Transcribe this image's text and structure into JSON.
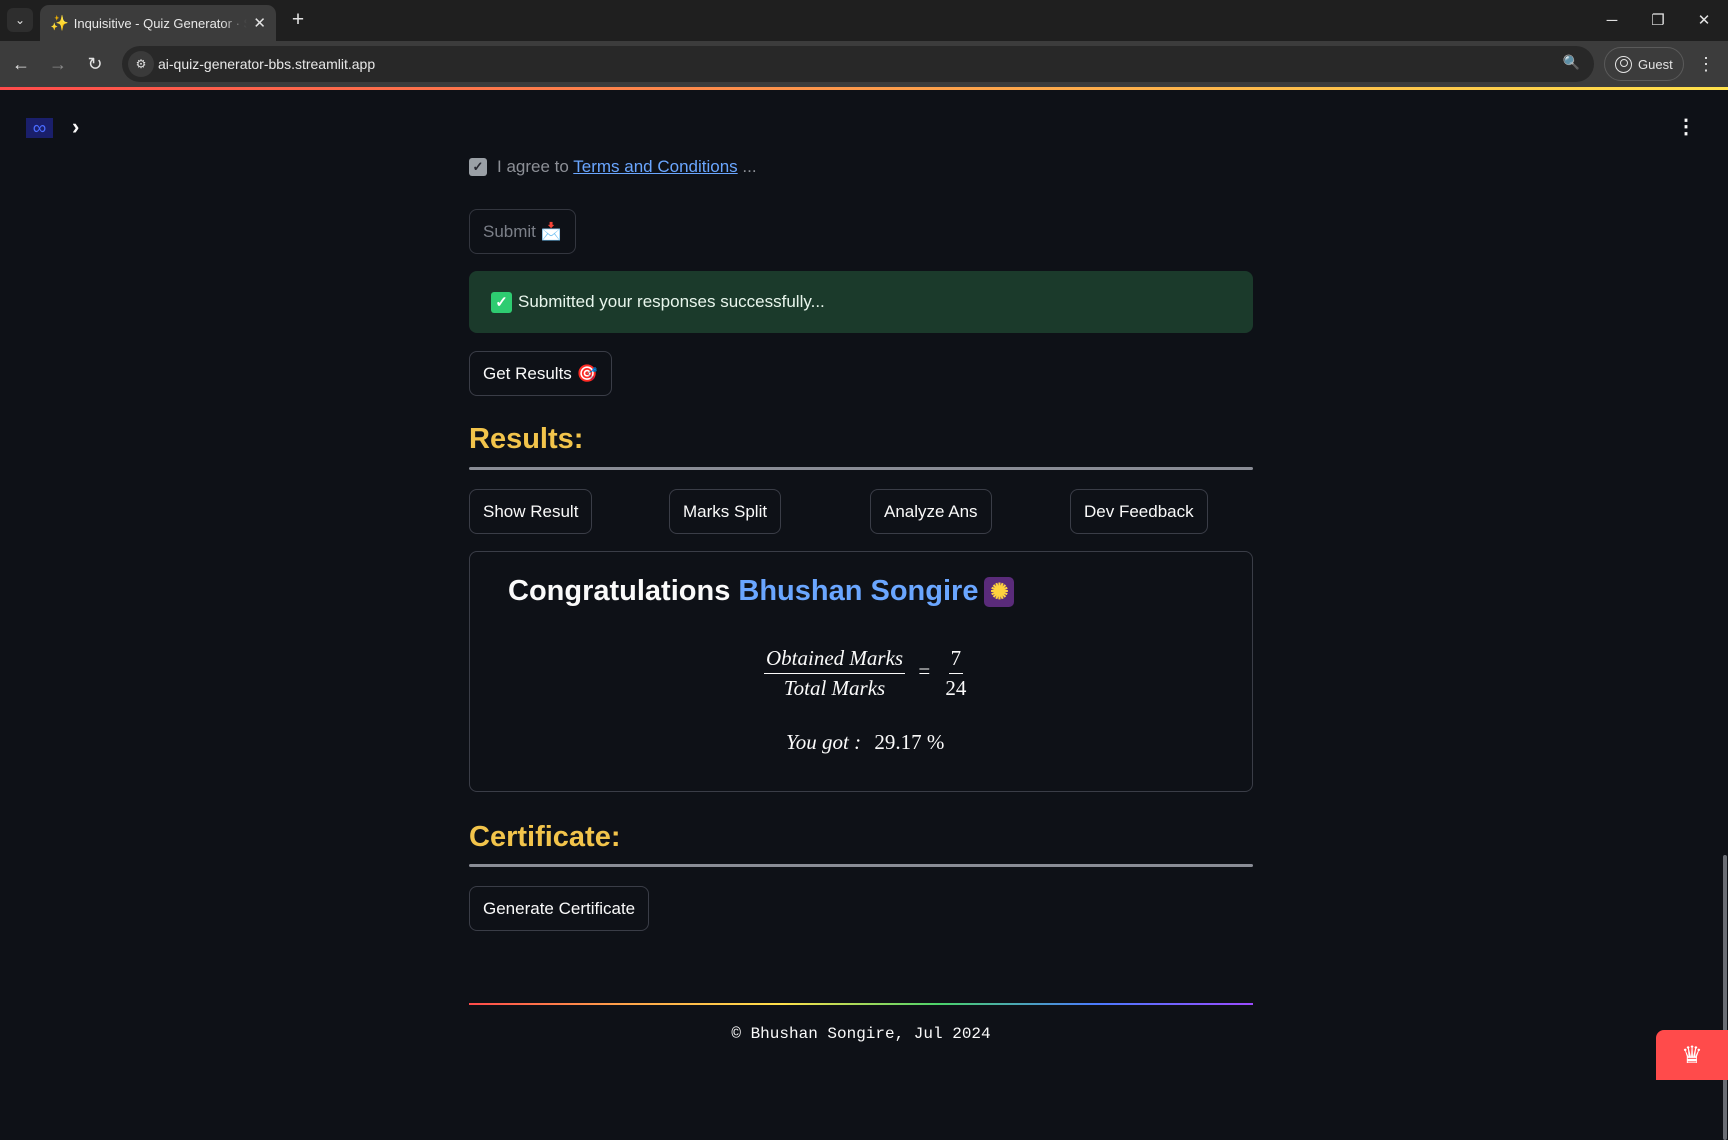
{
  "browser": {
    "tab_title": "Inquisitive - Quiz Generator · Streamlit",
    "tab_favicon": "sparkles-icon",
    "url": "ai-quiz-generator-bbs.streamlit.app",
    "profile_label": "Guest"
  },
  "app": {
    "logo_glyph": "∞",
    "agree": {
      "prefix": "I agree to ",
      "link_text": "Terms and Conditions",
      "suffix": " ...",
      "checked": true
    },
    "submit_label": "Submit 📩",
    "success_message": "Submitted your responses successfully...",
    "get_results_label": "Get Results 🎯",
    "results_heading": "Results:",
    "result_tabs": [
      "Show Result",
      "Marks Split",
      "Analyze Ans",
      "Dev Feedback"
    ],
    "result_card": {
      "congrats_prefix": "Congratulations ",
      "user_name": "Bhushan Songire",
      "emoji": "✺",
      "obtained_label": "Obtained Marks",
      "total_label": "Total Marks",
      "obtained_value": "7",
      "total_value": "24",
      "you_got_label": "You got :",
      "percentage": "29.17 %"
    },
    "certificate_heading": "Certificate:",
    "generate_certificate_label": "Generate Certificate",
    "footer": "© Bhushan Songire, Jul 2024"
  },
  "colors": {
    "background": "#0e1117",
    "heading_accent": "#f2c44b",
    "name_accent": "#6aa6ff",
    "success_bg": "#1b3a2b",
    "streamlit_red": "#ff4b4b"
  }
}
